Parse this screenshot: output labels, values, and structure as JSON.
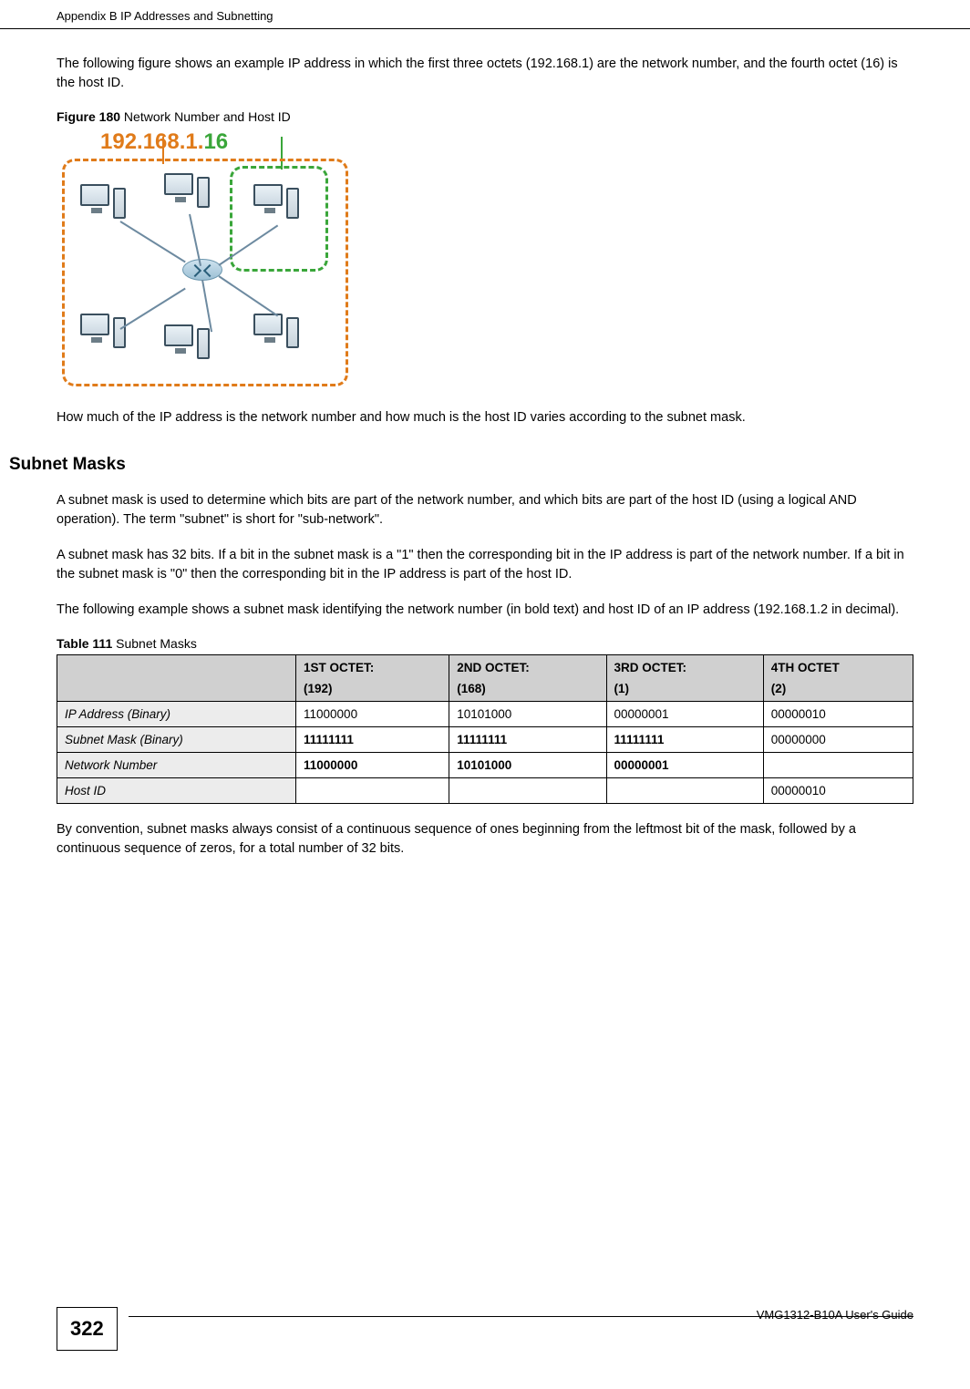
{
  "header": {
    "left": "Appendix B IP Addresses and Subnetting"
  },
  "intro_para": "The following figure shows an example IP address in which the first three octets (192.168.1) are the network number, and the fourth octet (16) is the host ID.",
  "figure": {
    "label_bold": "Figure 180",
    "label_rest": "   Network Number and Host ID",
    "ip_network": "192.168.1.",
    "ip_host": "16"
  },
  "after_figure_para": "How much of the IP address is the network number and how much is the host ID varies according to the subnet mask.",
  "section_heading": "Subnet Masks",
  "subnet_para1": "A subnet mask is used to determine which bits are part of the network number, and which bits are part of the host ID (using a logical AND operation). The term \"subnet\" is short for \"sub-network\".",
  "subnet_para2": "A subnet mask has 32 bits. If a bit in the subnet mask is a \"1\" then the corresponding bit in the IP address is part of the network number. If a bit in the subnet mask is \"0\" then the corresponding bit in the IP address is part of the host ID.",
  "subnet_para3": "The following example shows a subnet mask identifying the network number (in bold text) and host ID of an IP address (192.168.1.2 in decimal).",
  "table": {
    "caption_bold": "Table 111",
    "caption_rest": "   Subnet Masks",
    "headers": {
      "col1_line1": "1ST OCTET:",
      "col1_line2": "(192)",
      "col2_line1": "2ND OCTET:",
      "col2_line2": "(168)",
      "col3_line1": "3RD OCTET:",
      "col3_line2": "(1)",
      "col4_line1": "4TH OCTET",
      "col4_line2": "(2)"
    },
    "rows": [
      {
        "label": "IP Address (Binary)",
        "c1": "11000000",
        "c2": "10101000",
        "c3": "00000001",
        "c4": "00000010",
        "bold_cols": []
      },
      {
        "label": "Subnet Mask (Binary)",
        "c1": "11111111",
        "c2": "11111111",
        "c3": "11111111",
        "c4": "00000000",
        "bold_cols": [
          "c1",
          "c2",
          "c3"
        ]
      },
      {
        "label": "Network Number",
        "c1": "11000000",
        "c2": "10101000",
        "c3": "00000001",
        "c4": "",
        "bold_cols": [
          "c1",
          "c2",
          "c3"
        ]
      },
      {
        "label": "Host ID",
        "c1": "",
        "c2": "",
        "c3": "",
        "c4": "00000010",
        "bold_cols": []
      }
    ]
  },
  "closing_para": "By convention, subnet masks always consist of a continuous sequence of ones beginning from the leftmost bit of the mask, followed by a continuous sequence of zeros, for a total number of 32 bits.",
  "footer": {
    "page_number": "322",
    "guide": "VMG1312-B10A User's Guide"
  }
}
